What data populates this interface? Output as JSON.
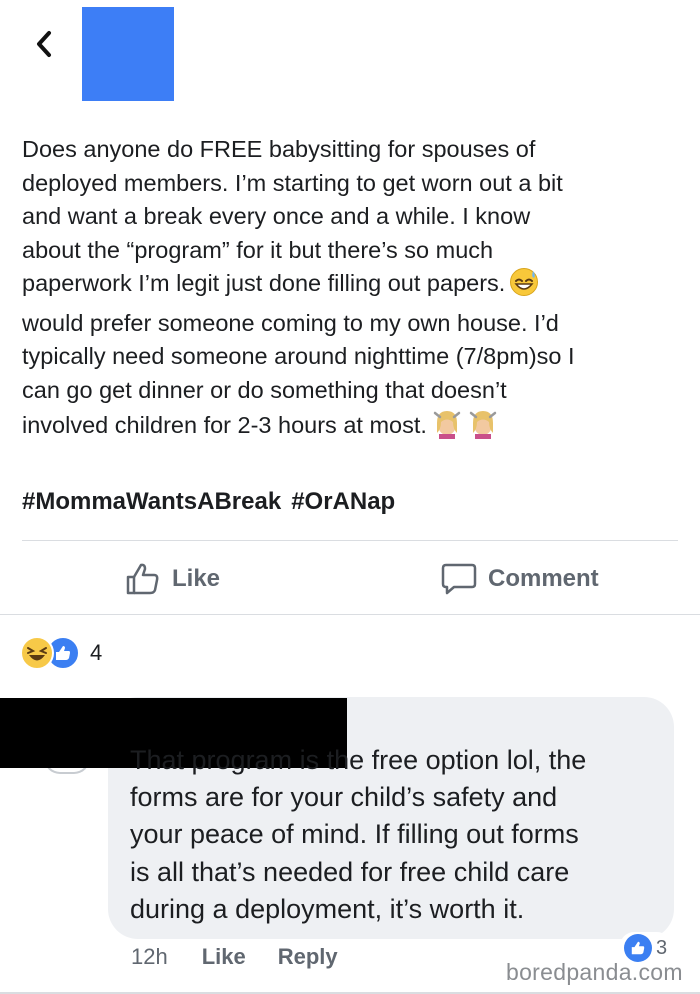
{
  "post": {
    "lines": [
      "Does anyone do FREE babysitting for spouses of",
      "deployed members. I’m starting to get worn out a bit",
      "and want a break every once and a while. I know",
      "about the “program” for it but there’s so much",
      "paperwork I’m legit just done filling out papers.",
      "would prefer someone coming to my own house. I’d",
      "typically need someone around nighttime (7/8pm)so I",
      "can go get dinner or do something that doesn’t",
      "involved children for 2-3 hours at most."
    ],
    "hashtags": [
      "#MommaWantsABreak",
      "#OrANap"
    ]
  },
  "actions": {
    "like_label": "Like",
    "comment_label": "Comment"
  },
  "reactions": {
    "count": "4"
  },
  "comment": {
    "lines": [
      "That program is the free option lol, the",
      "forms are for your child’s safety and",
      "your peace of mind.  If filling out forms",
      "is all that’s needed for free child care",
      "during a deployment, it’s worth it."
    ],
    "time": "12h",
    "like_label": "Like",
    "reply_label": "Reply",
    "reaction_count": "3"
  },
  "watermark": "boredpanda.com",
  "icons": {
    "back": "chevron-left-icon",
    "like": "thumbs-up-icon",
    "comment": "speech-bubble-icon",
    "sweat_emoji": "grinning-sweat-emoji-icon",
    "hair_emoji": "haircut-woman-emoji-icon"
  },
  "colors": {
    "redaction_blue": "#3d7ef6",
    "like_blue": "#3b7ff2",
    "haha_yellow": "#f7c948",
    "muted_text": "#606770",
    "bubble_bg": "#eef0f3"
  }
}
